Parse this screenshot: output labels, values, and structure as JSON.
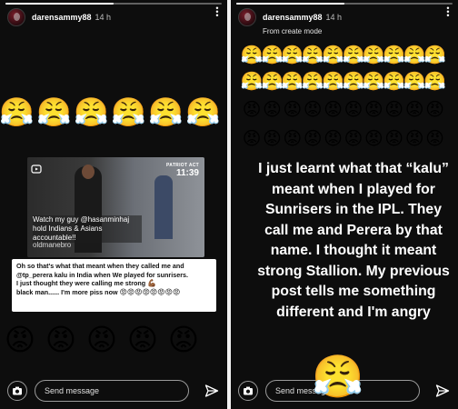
{
  "stories": [
    {
      "username": "darensammy88",
      "time": "14 h",
      "progress": 0.5,
      "emoji_rows": [
        {
          "glyph": "😤",
          "count": 6
        },
        {
          "glyph": "😡",
          "count": 5
        }
      ],
      "quote_card": {
        "clock": "11:39",
        "clock_tag": "PATRIOT ACT",
        "caption": "Watch my guy @hasanminhaj hold Indians & Asians accountable!!",
        "handle": "oldmanebro"
      },
      "text_block": {
        "line1": "Oh so that's what that meant when they called me and @tp_perera kalu in India when We played for sunrisers.",
        "line2": "I just thought they were calling me strong",
        "flex_emoji": "💪🏾",
        "line3": "black man...... I'm more piss now",
        "angry_emoji": "😡😡😡😡😡😡😡😡"
      },
      "footer": {
        "placeholder": "Send message",
        "camera_icon": "camera-icon",
        "send_icon": "send-icon"
      }
    },
    {
      "username": "darensammy88",
      "time": "14 h",
      "subheader": "From create mode",
      "progress": 0.5,
      "emoji_rows": [
        {
          "glyph": "😤",
          "count": 10
        },
        {
          "glyph": "😤",
          "count": 10
        },
        {
          "glyph": "😡",
          "count": 10
        },
        {
          "glyph": "😡",
          "count": 10
        }
      ],
      "big_text": "I just learnt what that “kalu” meant when I played for Sunrisers in the IPL. They call me and Perera by that name. I thought it meant strong Stallion. My previous post tells me something different and I'm angry",
      "sticker_emoji": "😤",
      "footer": {
        "placeholder": "Send message",
        "camera_icon": "camera-icon",
        "send_icon": "send-icon"
      }
    }
  ],
  "more_icon": "more-options-icon",
  "colors": {
    "background": "#0d0d0d",
    "text": "#ffffff",
    "card": "#ffffff",
    "border": "#9a9a9a"
  }
}
